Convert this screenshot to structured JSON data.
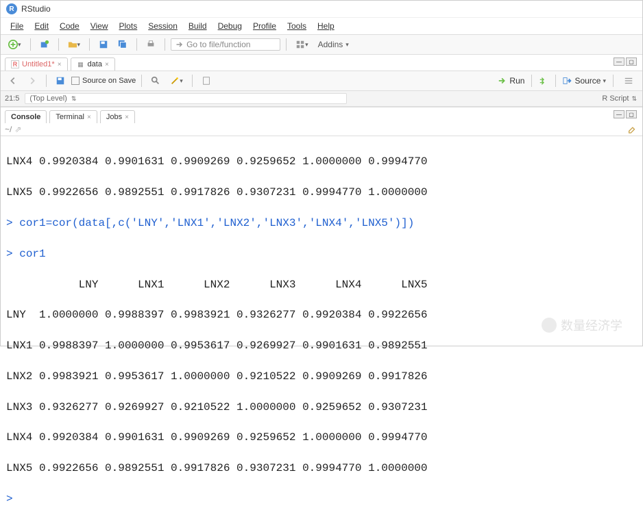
{
  "window": {
    "title": "RStudio"
  },
  "menu": {
    "file": "File",
    "edit": "Edit",
    "code": "Code",
    "view": "View",
    "plots": "Plots",
    "session": "Session",
    "build": "Build",
    "debug": "Debug",
    "profile": "Profile",
    "tools": "Tools",
    "help": "Help"
  },
  "toolbar1": {
    "goto_placeholder": "Go to file/function",
    "addins_label": "Addins"
  },
  "editor_tabs": {
    "tab1": "Untitled1*",
    "tab2": "data"
  },
  "toolbar2": {
    "source_on_save": "Source on Save",
    "run": "Run",
    "source": "Source"
  },
  "toolbar3": {
    "pos": "21:5",
    "scope": "(Top Level)",
    "rscript": "R Script"
  },
  "console_tabs": {
    "console": "Console",
    "terminal": "Terminal",
    "jobs": "Jobs"
  },
  "console_sub": {
    "path": "~/"
  },
  "console": {
    "pre_rows": [
      "LNX4 0.9920384 0.9901631 0.9909269 0.9259652 1.0000000 0.9994770",
      "LNX5 0.9922656 0.9892551 0.9917826 0.9307231 0.9994770 1.0000000"
    ],
    "cmd1": "cor1=cor(data[,c('LNY','LNX1','LNX2','LNX3','LNX4','LNX5')])",
    "cmd2": "cor1",
    "header": "           LNY      LNX1      LNX2      LNX3      LNX4      LNX5",
    "rows": [
      "LNY  1.0000000 0.9988397 0.9983921 0.9326277 0.9920384 0.9922656",
      "LNX1 0.9988397 1.0000000 0.9953617 0.9269927 0.9901631 0.9892551",
      "LNX2 0.9983921 0.9953617 1.0000000 0.9210522 0.9909269 0.9917826",
      "LNX3 0.9326277 0.9269927 0.9210522 1.0000000 0.9259652 0.9307231",
      "LNX4 0.9920384 0.9901631 0.9909269 0.9259652 1.0000000 0.9994770",
      "LNX5 0.9922656 0.9892551 0.9917826 0.9307231 0.9994770 1.0000000"
    ],
    "prompt": ">"
  },
  "watermark": "数量经济学"
}
